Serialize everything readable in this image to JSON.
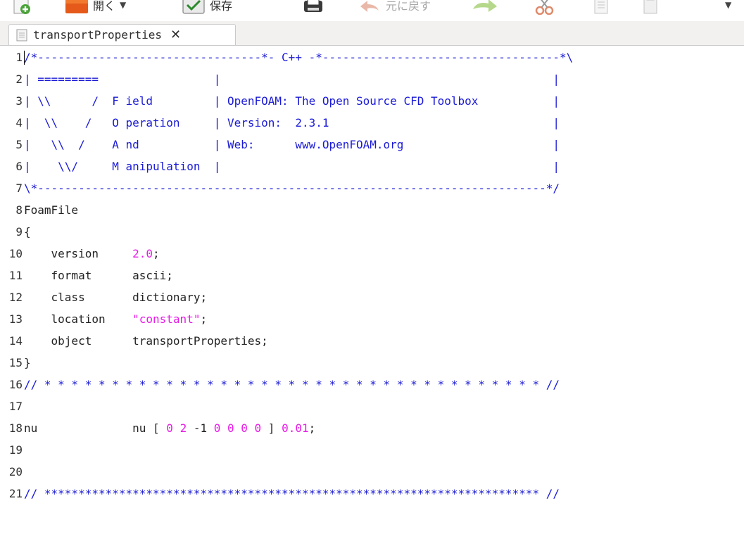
{
  "toolbar": {
    "open_label": "開く",
    "save_label": "保存",
    "undo_label": "元に戻す"
  },
  "tab": {
    "label": "transportProperties"
  },
  "editor": {
    "lines": [
      {
        "n": "1",
        "segs": [
          {
            "t": "/*---------------------------------*- C++ -*-----------------------------------*\\",
            "k": "comment"
          }
        ]
      },
      {
        "n": "2",
        "segs": [
          {
            "t": "| =========                 |                                                 |",
            "k": "comment"
          }
        ]
      },
      {
        "n": "3",
        "segs": [
          {
            "t": "| \\\\      /  F ield         | OpenFOAM: The Open Source CFD Toolbox           |",
            "k": "comment"
          }
        ]
      },
      {
        "n": "4",
        "segs": [
          {
            "t": "|  \\\\    /   O peration     | Version:  2.3.1                                 |",
            "k": "comment"
          }
        ]
      },
      {
        "n": "5",
        "segs": [
          {
            "t": "|   \\\\  /    A nd           | Web:      www.OpenFOAM.org                      |",
            "k": "comment"
          }
        ]
      },
      {
        "n": "6",
        "segs": [
          {
            "t": "|    \\\\/     M anipulation  |                                                 |",
            "k": "comment"
          }
        ]
      },
      {
        "n": "7",
        "segs": [
          {
            "t": "\\*---------------------------------------------------------------------------*/",
            "k": "comment"
          }
        ]
      },
      {
        "n": "8",
        "segs": [
          {
            "t": "FoamFile",
            "k": "plain"
          }
        ]
      },
      {
        "n": "9",
        "segs": [
          {
            "t": "{",
            "k": "plain"
          }
        ]
      },
      {
        "n": "10",
        "segs": [
          {
            "t": "    version     ",
            "k": "plain"
          },
          {
            "t": "2.0",
            "k": "num"
          },
          {
            "t": ";",
            "k": "plain"
          }
        ]
      },
      {
        "n": "11",
        "segs": [
          {
            "t": "    format      ascii;",
            "k": "plain"
          }
        ]
      },
      {
        "n": "12",
        "segs": [
          {
            "t": "    class       dictionary;",
            "k": "plain"
          }
        ]
      },
      {
        "n": "13",
        "segs": [
          {
            "t": "    location    ",
            "k": "plain"
          },
          {
            "t": "\"constant\"",
            "k": "str"
          },
          {
            "t": ";",
            "k": "plain"
          }
        ]
      },
      {
        "n": "14",
        "segs": [
          {
            "t": "    object      transportProperties;",
            "k": "plain"
          }
        ]
      },
      {
        "n": "15",
        "segs": [
          {
            "t": "}",
            "k": "plain"
          }
        ]
      },
      {
        "n": "16",
        "segs": [
          {
            "t": "// * * * * * * * * * * * * * * * * * * * * * * * * * * * * * * * * * * * * * //",
            "k": "comment"
          }
        ]
      },
      {
        "n": "17",
        "segs": []
      },
      {
        "n": "18",
        "segs": [
          {
            "t": "nu              nu [ ",
            "k": "plain"
          },
          {
            "t": "0 2 ",
            "k": "num"
          },
          {
            "t": "-1 ",
            "k": "plain"
          },
          {
            "t": "0 0 0 0",
            "k": "num"
          },
          {
            "t": " ] ",
            "k": "plain"
          },
          {
            "t": "0.01",
            "k": "num"
          },
          {
            "t": ";",
            "k": "plain"
          }
        ]
      },
      {
        "n": "19",
        "segs": []
      },
      {
        "n": "20",
        "segs": []
      },
      {
        "n": "21",
        "segs": [
          {
            "t": "// ************************************************************************* //",
            "k": "comment"
          }
        ]
      }
    ]
  },
  "colors": {
    "comment": "#1a1ad6",
    "number": "#e81ae8",
    "text": "#222222"
  }
}
